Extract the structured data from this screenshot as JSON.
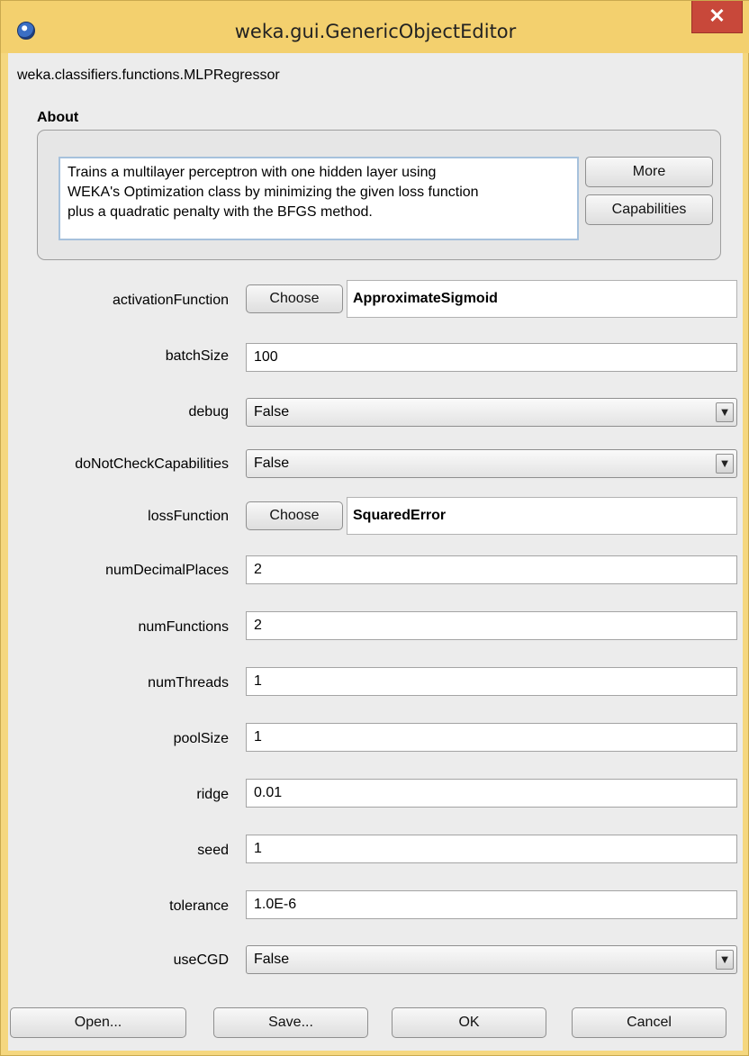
{
  "window": {
    "title": "weka.gui.GenericObjectEditor",
    "close_label": "✕"
  },
  "class_name": "weka.classifiers.functions.MLPRegressor",
  "about": {
    "title": "About",
    "lines": [
      "Trains a multilayer perceptron with one hidden layer using",
      "WEKA's Optimization class by minimizing the given loss function",
      "plus a quadratic penalty with the BFGS method."
    ],
    "more_label": "More",
    "capabilities_label": "Capabilities"
  },
  "properties": {
    "activationFunction": {
      "label": "activationFunction",
      "choose_label": "Choose",
      "value": "ApproximateSigmoid"
    },
    "batchSize": {
      "label": "batchSize",
      "value": "100"
    },
    "debug": {
      "label": "debug",
      "value": "False"
    },
    "doNotCheckCapabilities": {
      "label": "doNotCheckCapabilities",
      "value": "False"
    },
    "lossFunction": {
      "label": "lossFunction",
      "choose_label": "Choose",
      "value": "SquaredError"
    },
    "numDecimalPlaces": {
      "label": "numDecimalPlaces",
      "value": "2"
    },
    "numFunctions": {
      "label": "numFunctions",
      "value": "2"
    },
    "numThreads": {
      "label": "numThreads",
      "value": "1"
    },
    "poolSize": {
      "label": "poolSize",
      "value": "1"
    },
    "ridge": {
      "label": "ridge",
      "value": "0.01"
    },
    "seed": {
      "label": "seed",
      "value": "1"
    },
    "tolerance": {
      "label": "tolerance",
      "value": "1.0E-6"
    },
    "useCGD": {
      "label": "useCGD",
      "value": "False"
    }
  },
  "buttons": {
    "open": "Open...",
    "save": "Save...",
    "ok": "OK",
    "cancel": "Cancel"
  },
  "icons": {
    "app": "weka-bird-icon",
    "dropdown": "chevron-down-icon"
  },
  "colors": {
    "title_bar": "#f3d06e",
    "close_button": "#c8483a",
    "panel": "#ececec",
    "about_border": "#a6c1dc"
  }
}
